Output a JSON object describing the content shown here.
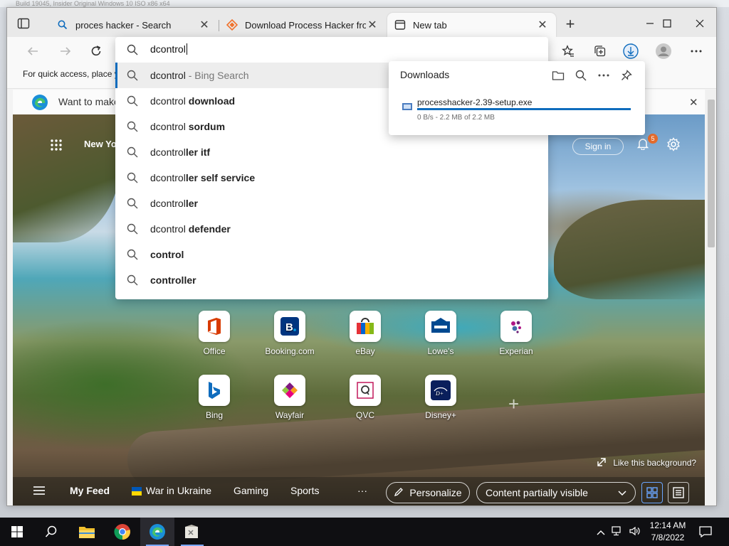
{
  "desktop": {
    "top_text": "Build 19045, Insider Original Windows 10 ISO x86 x64"
  },
  "tabs": [
    {
      "title": "proces hacker - Search",
      "icon": "bing-search-favicon"
    },
    {
      "title": "Download Process Hacker from SourceForge.net",
      "icon": "sourceforge-favicon"
    },
    {
      "title": "New tab",
      "icon": "new-tab-favicon",
      "active": true
    }
  ],
  "favorites_bar": {
    "text": "For quick access, place your favorites here on the favorites bar."
  },
  "infobar": {
    "text": "Want to make Microsoft Edge your default browser?"
  },
  "address": {
    "value": "dcontrol",
    "suggestions": [
      {
        "typed": "dcontrol",
        "rest": "",
        "hint": " - Bing Search",
        "selected": true
      },
      {
        "typed": "dcontrol ",
        "rest": "download"
      },
      {
        "typed": "dcontrol ",
        "rest": "sordum"
      },
      {
        "typed": "dcontrol",
        "rest": "ler itf"
      },
      {
        "typed": "dcontrol",
        "rest": "ler self service"
      },
      {
        "typed": "dcontrol",
        "rest": "ler"
      },
      {
        "typed": "dcontrol ",
        "rest": "defender"
      },
      {
        "typed": "",
        "rest": "control"
      },
      {
        "typed": "",
        "rest": "controller"
      }
    ]
  },
  "downloads": {
    "title": "Downloads",
    "file_name": "processhacker-2.39-setup.exe",
    "status": "0 B/s - 2.2 MB of 2.2 MB",
    "progress": 1.0
  },
  "newtab": {
    "location": "New York",
    "sign_in": "Sign in",
    "notification_count": "5",
    "tiles_row1": [
      {
        "label": "Office"
      },
      {
        "label": "Booking.com"
      },
      {
        "label": "eBay"
      },
      {
        "label": "Lowe's"
      },
      {
        "label": "Experian"
      }
    ],
    "tiles_row2": [
      {
        "label": "Bing"
      },
      {
        "label": "Wayfair"
      },
      {
        "label": "QVC"
      },
      {
        "label": "Disney+"
      }
    ],
    "like_background": "Like this background?",
    "feed": {
      "my_feed": "My Feed",
      "items": [
        "War in Ukraine",
        "Gaming",
        "Sports"
      ],
      "more": "···",
      "personalize": "Personalize",
      "content_visibility": "Content partially visible"
    }
  },
  "taskbar": {
    "time": "12:14 AM",
    "date": "7/8/2022"
  },
  "colors": {
    "accent": "#0f6cbd",
    "taskbar": "#0f0f12"
  }
}
